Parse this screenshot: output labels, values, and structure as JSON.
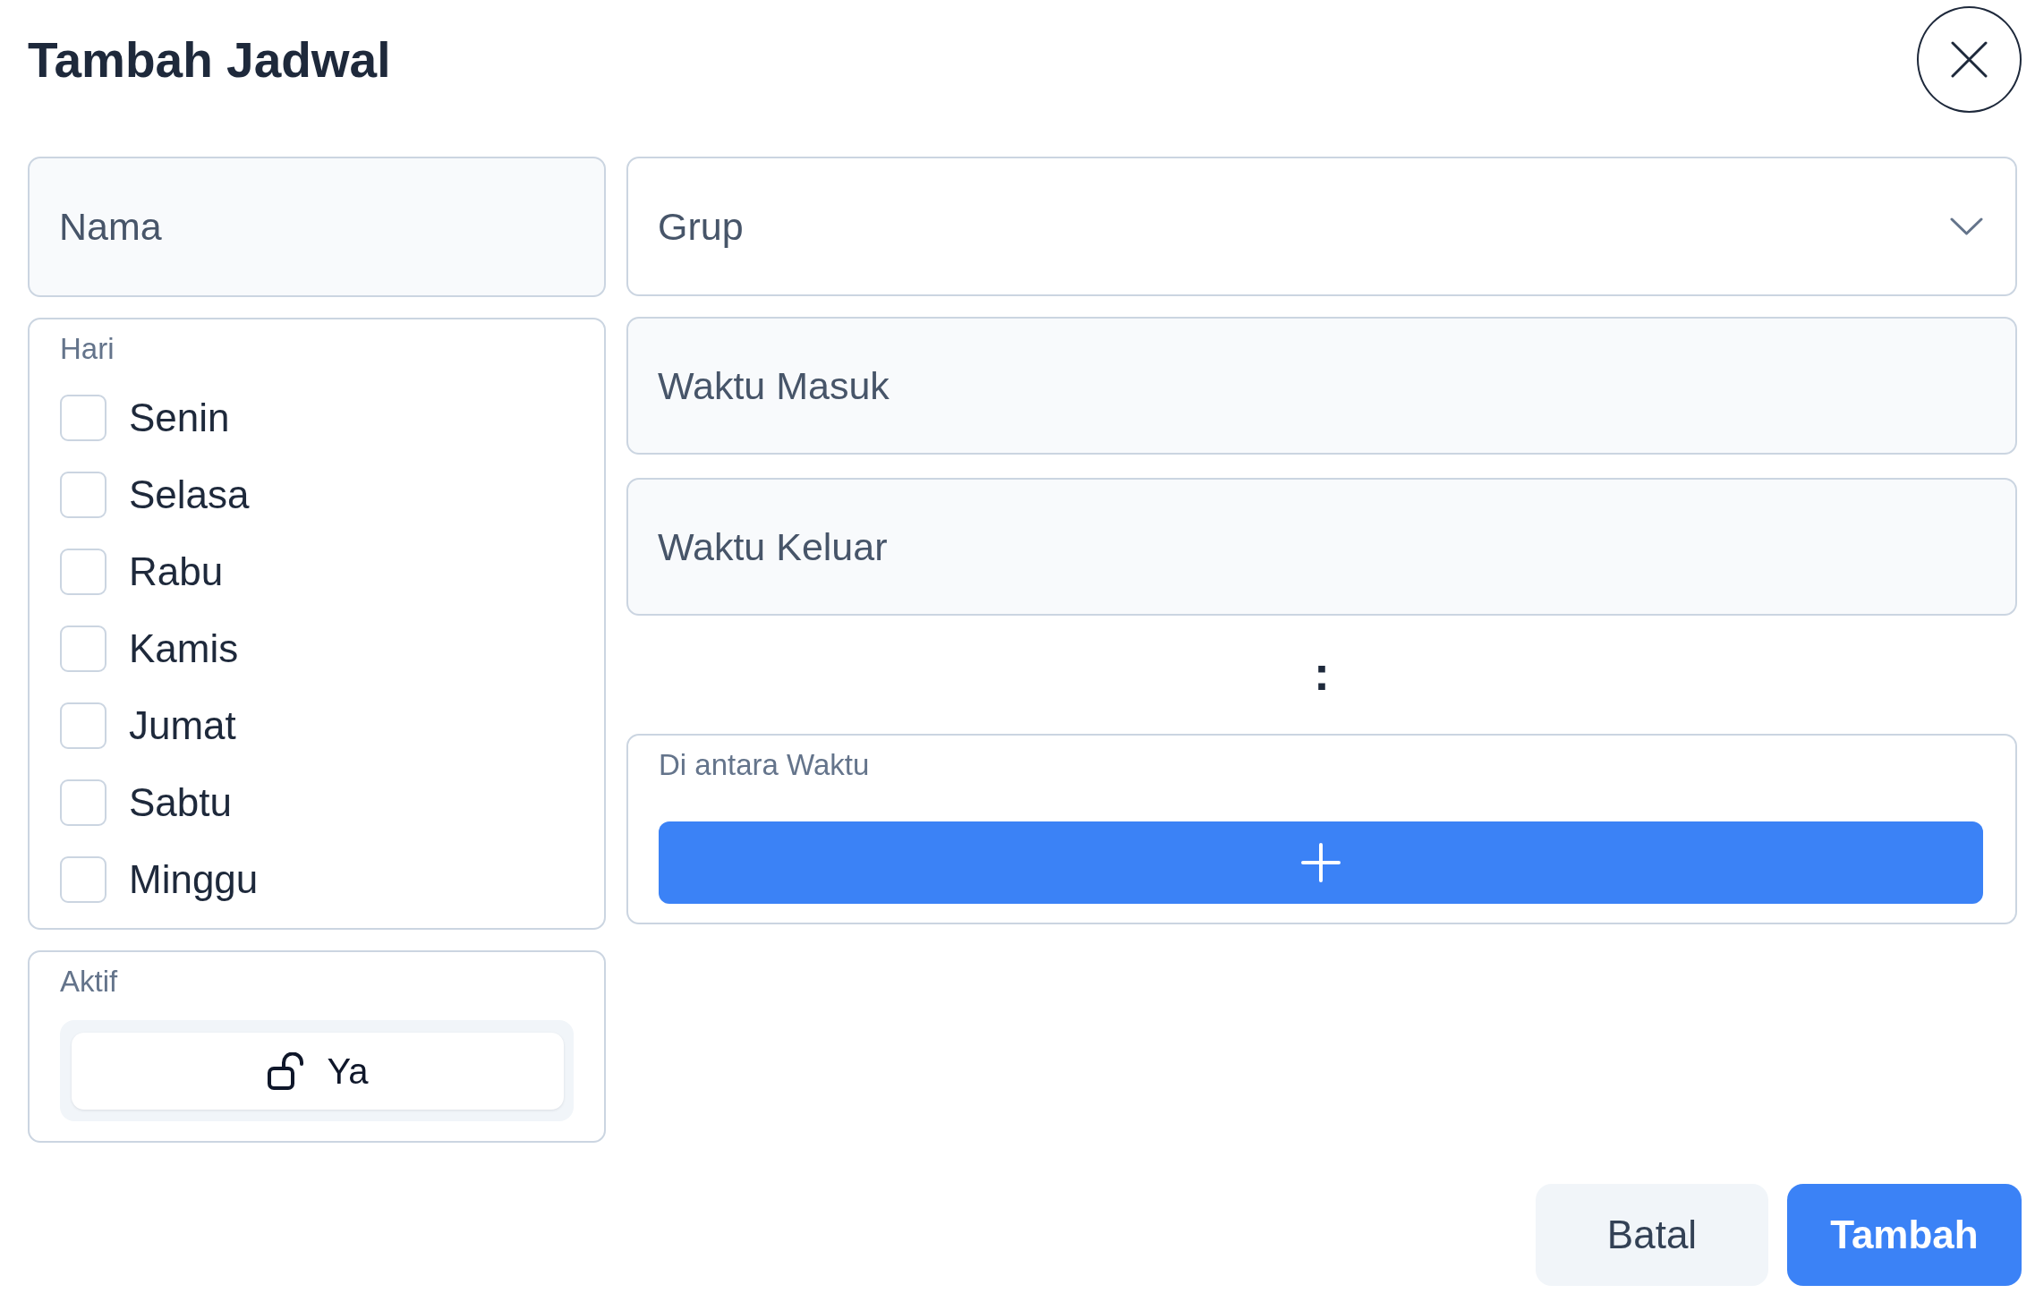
{
  "dialog": {
    "title": "Tambah Jadwal"
  },
  "name_field": {
    "placeholder": "Nama"
  },
  "group_select": {
    "placeholder": "Grup"
  },
  "days": {
    "label": "Hari",
    "options": [
      {
        "label": "Senin",
        "checked": false
      },
      {
        "label": "Selasa",
        "checked": false
      },
      {
        "label": "Rabu",
        "checked": false
      },
      {
        "label": "Kamis",
        "checked": false
      },
      {
        "label": "Jumat",
        "checked": false
      },
      {
        "label": "Sabtu",
        "checked": false
      },
      {
        "label": "Minggu",
        "checked": false
      }
    ]
  },
  "active": {
    "label": "Aktif",
    "options": [
      {
        "label": "Ya",
        "selected": true
      }
    ]
  },
  "time_in_field": {
    "placeholder": "Waktu Masuk"
  },
  "time_out_field": {
    "placeholder": "Waktu Keluar"
  },
  "separator": ":",
  "between_times": {
    "label": "Di antara Waktu"
  },
  "buttons": [
    {
      "label": "Batal",
      "kind": "secondary"
    },
    {
      "label": "Tambah",
      "kind": "primary"
    }
  ]
}
